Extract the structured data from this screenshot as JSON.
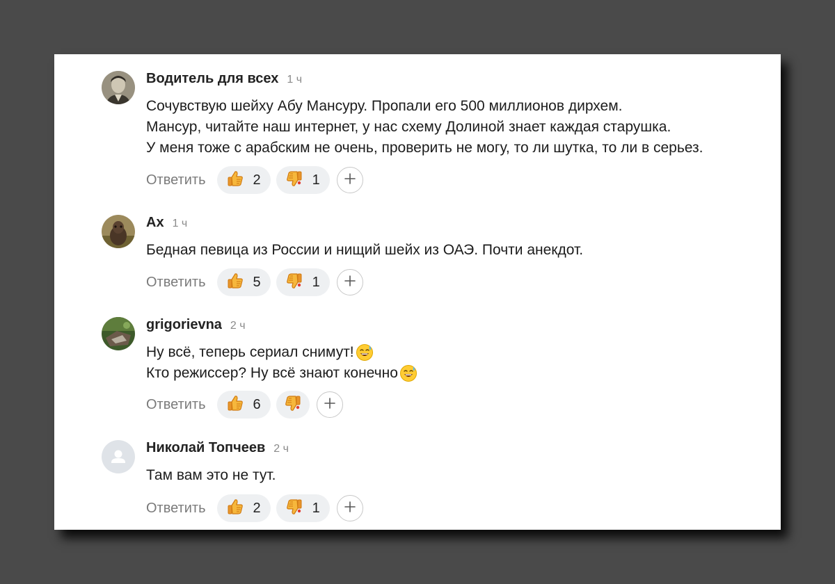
{
  "reply_label": "Ответить",
  "icons": {
    "like": "thumbs-up-icon",
    "dislike": "thumbs-down-icon",
    "add_reaction": "plus-icon",
    "sweat_smile": "sweat-smile-emoji-icon",
    "default_avatar": "user-icon"
  },
  "comments": [
    {
      "author": "Водитель для всех",
      "time": "1 ч",
      "lines": [
        "Сочувствую шейху Абу Мансуру. Пропали его 500 миллионов дирхем.",
        "Мансур, читайте наш интернет, у нас схему Долиной знает каждая старушка.",
        "У меня тоже с арабским не очень, проверить не могу, то ли шутка, то ли в серьез."
      ],
      "likes": "2",
      "dislikes": "1"
    },
    {
      "author": "Ах",
      "time": "1 ч",
      "lines": [
        "Бедная певица из России и нищий шейх из ОАЭ. Почти анекдот."
      ],
      "likes": "5",
      "dislikes": "1"
    },
    {
      "author": "grigorievna",
      "time": "2 ч",
      "lines": [
        "Ну всё, теперь сериал снимут!",
        "Кто режиссер? Ну всё знают конечно"
      ],
      "likes": "6",
      "dislikes": ""
    },
    {
      "author": "Николай Топчеев",
      "time": "2 ч",
      "lines": [
        "Там вам это не тут."
      ],
      "likes": "2",
      "dislikes": "1"
    }
  ]
}
